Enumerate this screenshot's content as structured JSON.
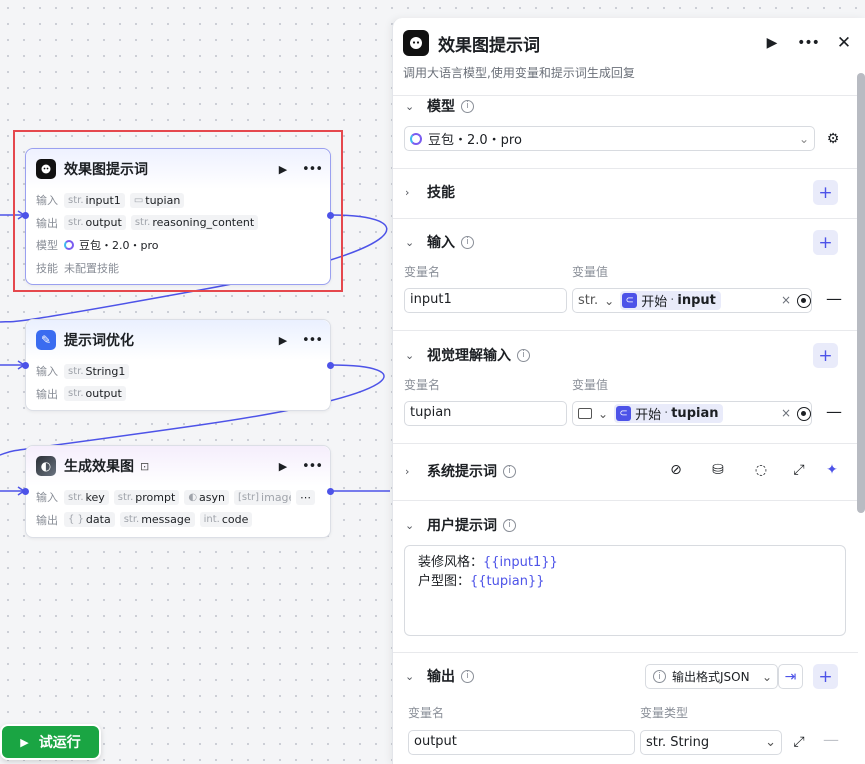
{
  "canvas": {
    "nodes": [
      {
        "title": "效果图提示词",
        "rows": [
          {
            "label": "输入",
            "tags": [
              {
                "type": "str.",
                "name": "input1"
              },
              {
                "type": "img",
                "name": "tupian"
              }
            ]
          },
          {
            "label": "输出",
            "tags": [
              {
                "type": "str.",
                "name": "output"
              },
              {
                "type": "str.",
                "name": "reasoning_content"
              }
            ]
          },
          {
            "label": "模型",
            "value": "豆包・2.0・pro"
          },
          {
            "label": "技能",
            "value": "未配置技能"
          }
        ]
      },
      {
        "title": "提示词优化",
        "rows": [
          {
            "label": "输入",
            "tags": [
              {
                "type": "str.",
                "name": "String1"
              }
            ]
          },
          {
            "label": "输出",
            "tags": [
              {
                "type": "str.",
                "name": "output"
              }
            ]
          }
        ]
      },
      {
        "title": "生成效果图",
        "rows": [
          {
            "label": "输入",
            "tags": [
              {
                "type": "str.",
                "name": "key"
              },
              {
                "type": "str.",
                "name": "prompt"
              },
              {
                "type": "bool",
                "name": "asyn"
              },
              {
                "type": "[str]",
                "name": "image_url"
              }
            ]
          },
          {
            "label": "输出",
            "tags": [
              {
                "type": "{ }",
                "name": "data"
              },
              {
                "type": "str.",
                "name": "message"
              },
              {
                "type": "int.",
                "name": "code"
              }
            ]
          }
        ]
      }
    ],
    "run_button": "试运行"
  },
  "panel": {
    "title": "效果图提示词",
    "description": "调用大语言模型,使用变量和提示词生成回复",
    "model": {
      "label": "模型",
      "value": "豆包・2.0・pro"
    },
    "skills": {
      "label": "技能"
    },
    "inputs": {
      "label": "输入",
      "col_name": "变量名",
      "col_value": "变量值",
      "rows": [
        {
          "name": "input1",
          "type": "str.",
          "ref_node": "开始",
          "ref_var": "input"
        }
      ]
    },
    "vision_inputs": {
      "label": "视觉理解输入",
      "col_name": "变量名",
      "col_value": "变量值",
      "rows": [
        {
          "name": "tupian",
          "ref_node": "开始",
          "ref_var": "tupian"
        }
      ]
    },
    "system_prompt": {
      "label": "系统提示词"
    },
    "user_prompt": {
      "label": "用户提示词",
      "line1_prefix": "装修风格：",
      "line1_var": "{{input1}}",
      "line2_prefix": "户型图：",
      "line2_var": "{{tupian}}"
    },
    "output": {
      "label": "输出",
      "format": "输出格式JSON",
      "col_name": "变量名",
      "col_type": "变量类型",
      "rows": [
        {
          "name": "output",
          "type": "str. String"
        }
      ]
    }
  },
  "colors": {
    "accent": "#4d53e8",
    "run_green": "#1aa543",
    "highlight": "#e5484d"
  }
}
